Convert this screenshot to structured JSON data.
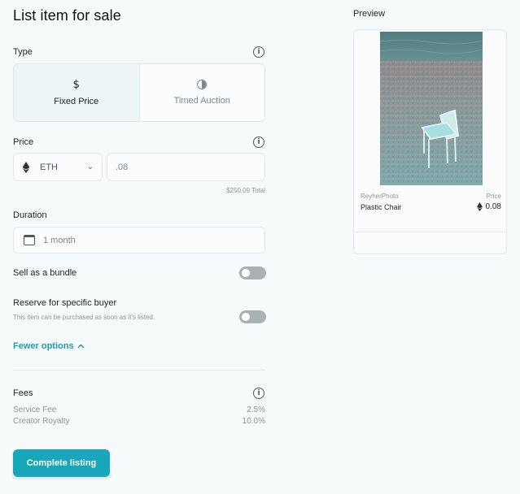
{
  "page": {
    "title": "List item for sale"
  },
  "type": {
    "label": "Type",
    "options": [
      {
        "label": "Fixed Price",
        "icon": "dollar-icon",
        "selected": true
      },
      {
        "label": "Timed Auction",
        "icon": "timer-icon",
        "selected": false
      }
    ]
  },
  "price": {
    "label": "Price",
    "currency": "ETH",
    "value": ".08",
    "total": "$250.09 Total"
  },
  "duration": {
    "label": "Duration",
    "value": "1 month"
  },
  "bundle": {
    "label": "Sell as a bundle",
    "enabled": false
  },
  "reserve": {
    "label": "Reserve for specific buyer",
    "help": "This item can be purchased as soon as it's listed.",
    "enabled": false
  },
  "fewer_options": {
    "label": "Fewer options"
  },
  "fees": {
    "label": "Fees",
    "rows": [
      {
        "name": "Service Fee",
        "value": "2.5%"
      },
      {
        "name": "Creator Royalty",
        "value": "10.0%"
      }
    ]
  },
  "cta": {
    "label": "Complete listing"
  },
  "preview": {
    "label": "Preview",
    "creator": "ReyherPhoto",
    "item_name": "Plastic Chair",
    "price_label": "Price",
    "price_value": "0.08"
  },
  "colors": {
    "accent": "#18a6bb",
    "link": "#1a9fb0",
    "toggle_off": "#a8b2b5"
  }
}
